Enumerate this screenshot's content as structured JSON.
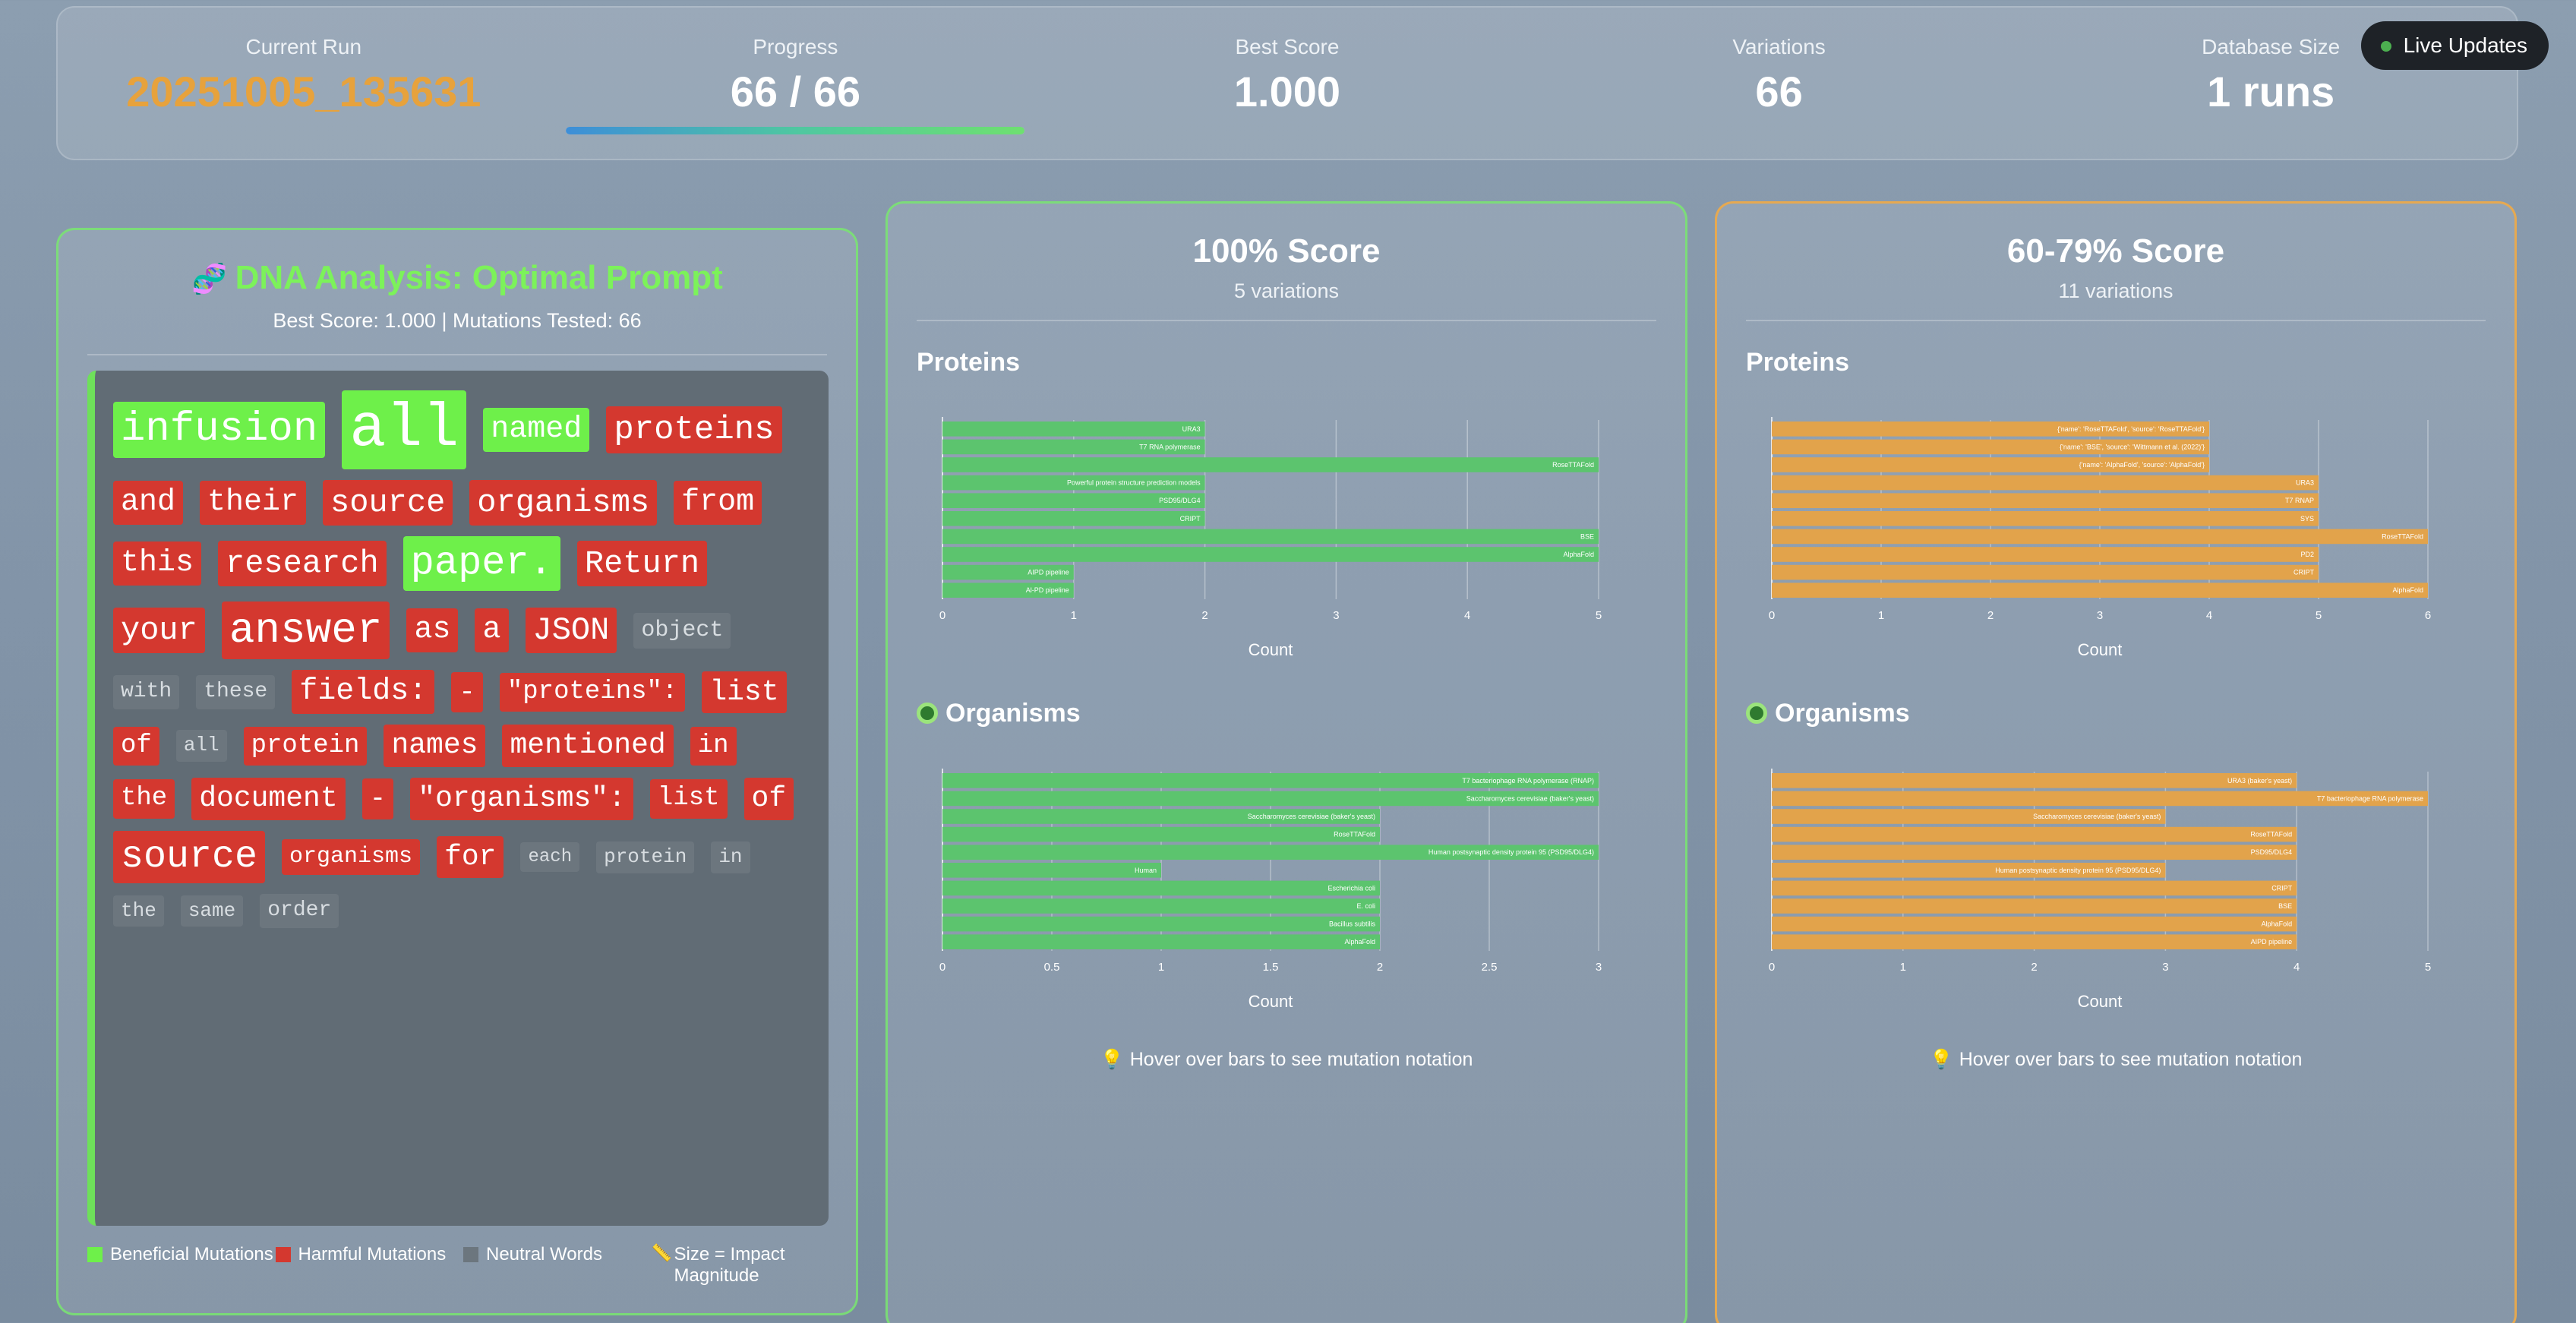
{
  "stats": {
    "current_run_label": "Current Run",
    "current_run_value": "20251005_135631",
    "progress_label": "Progress",
    "progress_value": "66 / 66",
    "progress_fraction": 1.0,
    "best_score_label": "Best Score",
    "best_score_value": "1.000",
    "variations_label": "Variations",
    "variations_value": "66",
    "database_label": "Database Size",
    "database_value": "1 runs"
  },
  "live_updates": {
    "label": "Live Updates",
    "dot_color": "#4caf50"
  },
  "left_panel": {
    "title": "DNA Analysis: Optimal Prompt",
    "title_icon": "dna-icon",
    "subtitle": "Best Score: 1.000 | Mutations Tested: 66",
    "words": [
      {
        "t": "infusion",
        "k": "b",
        "s": 54
      },
      {
        "t": "all",
        "k": "b",
        "s": 80
      },
      {
        "t": "named",
        "k": "b",
        "s": 40
      },
      {
        "t": "proteins",
        "k": "h",
        "s": 44
      },
      {
        "t": "and",
        "k": "h",
        "s": 40
      },
      {
        "t": "their",
        "k": "h",
        "s": 40
      },
      {
        "t": "source",
        "k": "h",
        "s": 42
      },
      {
        "t": "organisms",
        "k": "h",
        "s": 42
      },
      {
        "t": "from",
        "k": "h",
        "s": 40
      },
      {
        "t": "this",
        "k": "h",
        "s": 40
      },
      {
        "t": "research",
        "k": "h",
        "s": 42
      },
      {
        "t": "paper.",
        "k": "b",
        "s": 52
      },
      {
        "t": "Return",
        "k": "h",
        "s": 42
      },
      {
        "t": "your",
        "k": "h",
        "s": 42
      },
      {
        "t": "answer",
        "k": "h",
        "s": 56
      },
      {
        "t": "as",
        "k": "h",
        "s": 40
      },
      {
        "t": "a",
        "k": "h",
        "s": 40
      },
      {
        "t": "JSON",
        "k": "h",
        "s": 42
      },
      {
        "t": "object",
        "k": "n",
        "s": 30
      },
      {
        "t": "with",
        "k": "n",
        "s": 28
      },
      {
        "t": "these",
        "k": "n",
        "s": 28
      },
      {
        "t": "fields:",
        "k": "h",
        "s": 40
      },
      {
        "t": "-",
        "k": "h",
        "s": 36
      },
      {
        "t": "\"proteins\":",
        "k": "h",
        "s": 34
      },
      {
        "t": "list",
        "k": "h",
        "s": 38
      },
      {
        "t": "of",
        "k": "h",
        "s": 34
      },
      {
        "t": "all",
        "k": "n",
        "s": 26
      },
      {
        "t": "protein",
        "k": "h",
        "s": 34
      },
      {
        "t": "names",
        "k": "h",
        "s": 38
      },
      {
        "t": "mentioned",
        "k": "h",
        "s": 38
      },
      {
        "t": "in",
        "k": "h",
        "s": 34
      },
      {
        "t": "the",
        "k": "h",
        "s": 34
      },
      {
        "t": "document",
        "k": "h",
        "s": 38
      },
      {
        "t": "-",
        "k": "h",
        "s": 36
      },
      {
        "t": "\"organisms\":",
        "k": "h",
        "s": 38
      },
      {
        "t": "list",
        "k": "h",
        "s": 34
      },
      {
        "t": "of",
        "k": "h",
        "s": 38
      },
      {
        "t": "source",
        "k": "h",
        "s": 50
      },
      {
        "t": "organisms",
        "k": "h",
        "s": 30
      },
      {
        "t": "for",
        "k": "h",
        "s": 38
      },
      {
        "t": "each",
        "k": "n",
        "s": 24
      },
      {
        "t": "protein",
        "k": "n",
        "s": 26
      },
      {
        "t": "in",
        "k": "n",
        "s": 26
      },
      {
        "t": "the",
        "k": "n",
        "s": 26
      },
      {
        "t": "same",
        "k": "n",
        "s": 26
      },
      {
        "t": "order",
        "k": "n",
        "s": 28
      }
    ],
    "legend": [
      {
        "label": "Beneficial Mutations",
        "color": "#6ef04a",
        "icon": "square"
      },
      {
        "label": "Harmful Mutations",
        "color": "#d4382f",
        "icon": "square"
      },
      {
        "label": "Neutral Words",
        "color": "#6c767e",
        "icon": "square"
      },
      {
        "label": "Size = Impact Magnitude",
        "color": "#d8e2ea",
        "icon": "ruler-icon"
      }
    ]
  },
  "middle_panel": {
    "title": "100% Score",
    "subtitle": "5 variations",
    "proteins_title": "Proteins",
    "organisms_title": "Organisms",
    "hint": "Hover over bars to see mutation notation",
    "bar_color": "#5cc46e"
  },
  "right_panel": {
    "title": "60-79% Score",
    "subtitle": "11 variations",
    "proteins_title": "Proteins",
    "organisms_title": "Organisms",
    "hint": "Hover over bars to see mutation notation",
    "bar_color": "#e2a34b"
  },
  "chart_data": [
    {
      "id": "mid-proteins",
      "type": "bar",
      "orientation": "horizontal",
      "xlabel": "Count",
      "xlim": [
        0,
        5
      ],
      "ticks": [
        0,
        1,
        2,
        3,
        4,
        5
      ],
      "categories": [
        "URA3",
        "T7 RNA polymerase",
        "RoseTTAFold",
        "Powerful protein structure prediction models",
        "PSD95/DLG4",
        "CRIPT",
        "BSE",
        "AlphaFold",
        "AIPD pipeline",
        "Al-PD pipeline"
      ],
      "values": [
        2,
        2,
        5,
        2,
        2,
        2,
        5,
        5,
        1,
        1
      ]
    },
    {
      "id": "mid-organisms",
      "type": "bar",
      "orientation": "horizontal",
      "xlabel": "Count",
      "xlim": [
        0,
        3
      ],
      "ticks": [
        0,
        0.5,
        1,
        1.5,
        2,
        2.5,
        3
      ],
      "categories": [
        "T7 bacteriophage RNA polymerase (RNAP)",
        "Saccharomyces cerevisiae (baker's yeast)",
        "Saccharomyces cerevisiae (baker's yeast)",
        "RoseTTAFold",
        "Human postsynaptic density protein 95 (PSD95/DLG4)",
        "Human",
        "Escherichia coli",
        "E. coli",
        "Bacillus subtilis",
        "AlphaFold"
      ],
      "values": [
        3,
        3,
        2,
        2,
        3,
        1,
        2,
        2,
        2,
        2
      ]
    },
    {
      "id": "right-proteins",
      "type": "bar",
      "orientation": "horizontal",
      "xlabel": "Count",
      "xlim": [
        0,
        6
      ],
      "ticks": [
        0,
        1,
        2,
        3,
        4,
        5,
        6
      ],
      "categories": [
        "{'name': 'RoseTTAFold', 'source': 'RoseTTAFold'}",
        "{'name': 'BSE', 'source': 'Wittmann et al. (2022)'}",
        "{'name': 'AlphaFold', 'source': 'AlphaFold'}",
        "URA3",
        "T7 RNAP",
        "SYS",
        "RoseTTAFold",
        "PD2",
        "CRIPT",
        "AlphaFold"
      ],
      "values": [
        4,
        4,
        4,
        5,
        5,
        5,
        6,
        5,
        5,
        6
      ]
    },
    {
      "id": "right-organisms",
      "type": "bar",
      "orientation": "horizontal",
      "xlabel": "Count",
      "xlim": [
        0,
        5
      ],
      "ticks": [
        0,
        1,
        2,
        3,
        4,
        5
      ],
      "categories": [
        "URA3 (baker's yeast)",
        "T7 bacteriophage RNA polymerase",
        "Saccharomyces cerevisiae (baker's yeast)",
        "RoseTTAFold",
        "PSD95/DLG4",
        "Human postsynaptic density protein 95 (PSD95/DLG4)",
        "CRIPT",
        "BSE",
        "AlphaFold",
        "AIPD pipeline"
      ],
      "values": [
        4,
        5,
        3,
        4,
        4,
        3,
        4,
        4,
        4,
        4
      ]
    }
  ]
}
